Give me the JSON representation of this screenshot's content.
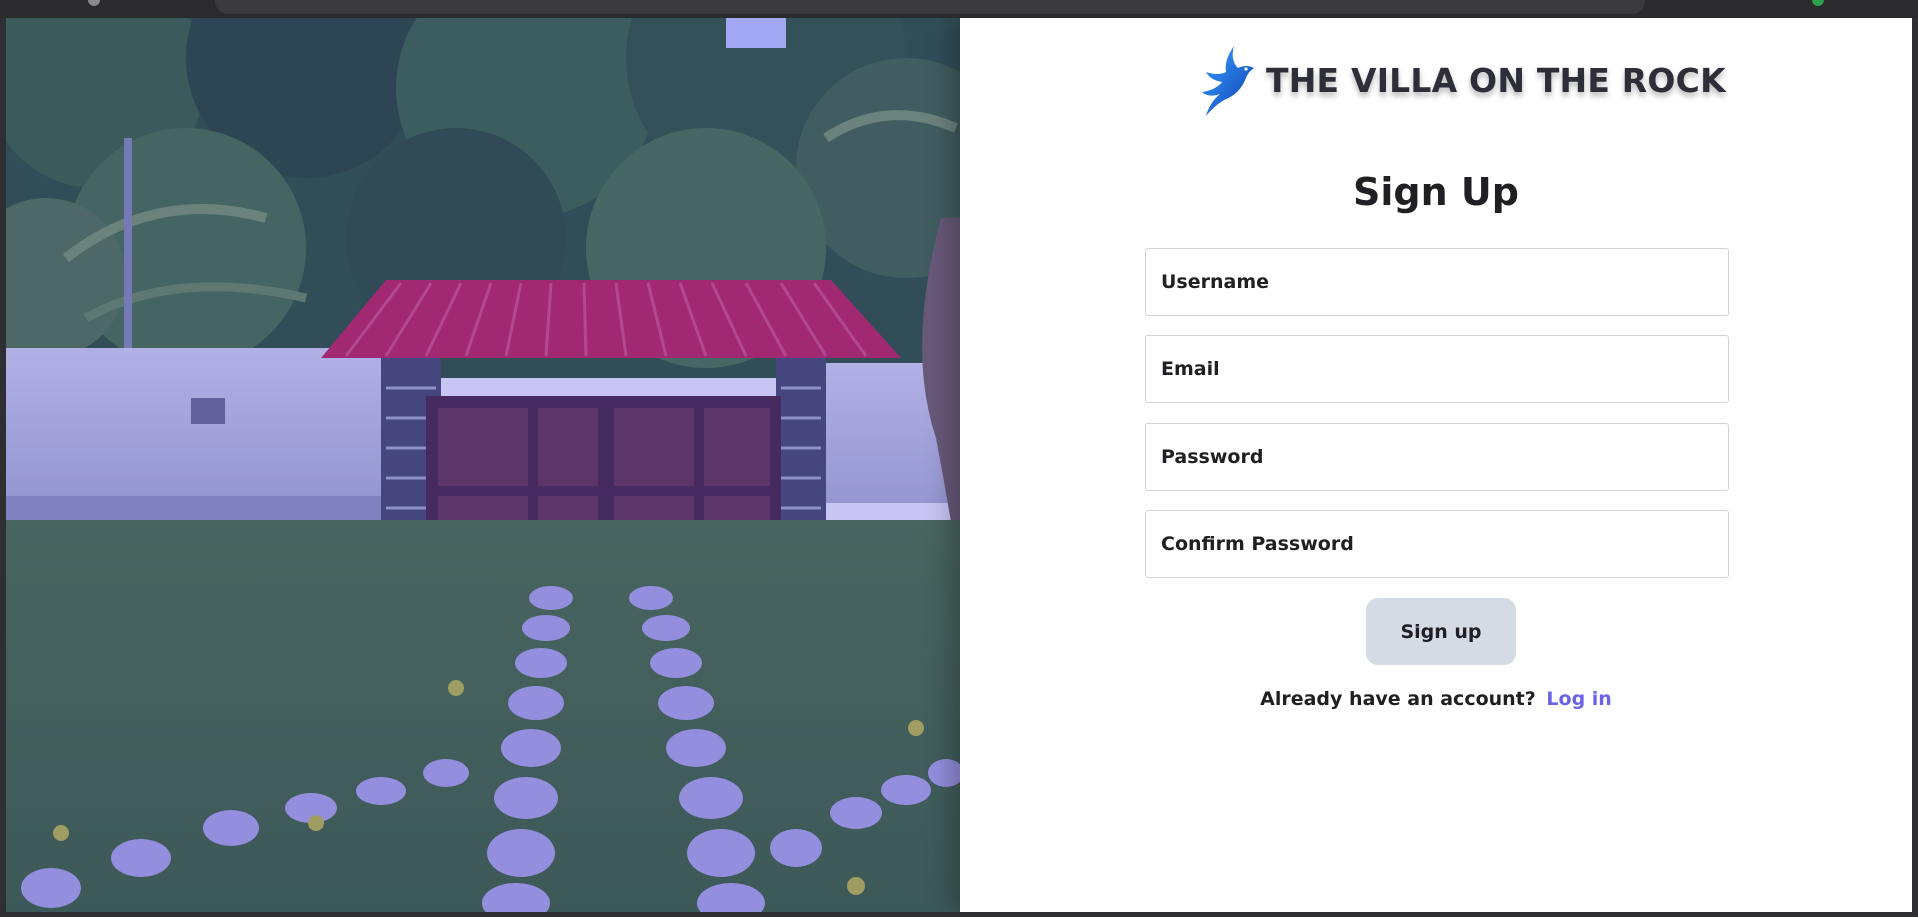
{
  "brand": {
    "name": "THE VILLA ON THE ROCK",
    "logo_icon": "bird-logo-icon",
    "logo_color": "#1a5fd1"
  },
  "hero": {
    "image_icon": "villa-gate-photo",
    "tint_color": "#3a2fd0"
  },
  "form": {
    "title": "Sign Up",
    "fields": {
      "username": {
        "placeholder": "Username",
        "value": ""
      },
      "email": {
        "placeholder": "Email",
        "value": ""
      },
      "password": {
        "placeholder": "Password",
        "value": ""
      },
      "confirm_password": {
        "placeholder": "Confirm Password",
        "value": ""
      }
    },
    "submit_label": "Sign up",
    "login_prompt": "Already have an account?",
    "login_link": "Log in"
  },
  "colors": {
    "link": "#6a63e8",
    "button_bg": "#d5dbe4",
    "text": "#1f1f24"
  }
}
